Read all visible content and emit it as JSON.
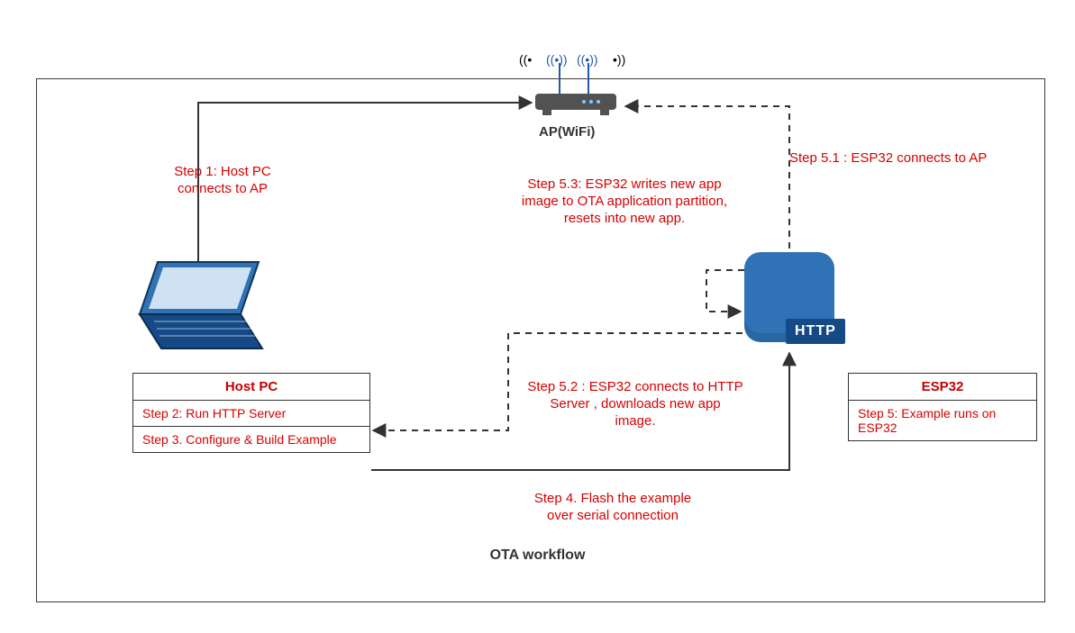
{
  "diagram": {
    "title": "OTA workflow",
    "ap_label": "AP(WiFi)"
  },
  "host_pc": {
    "title": "Host PC",
    "step2": "Step 2: Run HTTP Server",
    "step3": "Step 3. Configure & Build Example"
  },
  "esp32": {
    "title": "ESP32",
    "step5": "Step 5: Example runs on ESP32",
    "http_badge": "HTTP"
  },
  "labels": {
    "step1_line1": "Step 1: Host PC",
    "step1_line2": "connects to AP",
    "step4_line1": "Step 4. Flash the example",
    "step4_line2": "over serial connection",
    "step51": "Step 5.1 :  ESP32 connects to AP",
    "step52_line1": "Step 5.2 :  ESP32 connects to HTTP",
    "step52_line2": "Server , downloads new app",
    "step52_line3": "image.",
    "step53_line1": "Step 5.3:  ESP32 writes new app",
    "step53_line2": "image to OTA application partition,",
    "step53_line3": "resets into new app."
  },
  "chart_data": {
    "type": "diagram",
    "title": "OTA workflow",
    "nodes": [
      {
        "id": "host_pc",
        "label": "Host PC",
        "details": [
          "Step 2: Run HTTP Server",
          "Step 3. Configure & Build Example"
        ]
      },
      {
        "id": "ap",
        "label": "AP(WiFi)"
      },
      {
        "id": "esp32",
        "label": "ESP32",
        "details": [
          "Step 5: Example runs on ESP32"
        ],
        "badge": "HTTP"
      }
    ],
    "edges": [
      {
        "from": "host_pc",
        "to": "ap",
        "style": "solid",
        "label": "Step 1: Host PC connects to AP"
      },
      {
        "from": "host_pc",
        "to": "esp32",
        "style": "solid",
        "label": "Step 4. Flash the example over serial connection"
      },
      {
        "from": "esp32",
        "to": "ap",
        "style": "dashed",
        "label": "Step 5.1 :  ESP32 connects to AP"
      },
      {
        "from": "esp32",
        "to": "host_pc",
        "style": "dashed",
        "label": "Step 5.2 :  ESP32 connects to HTTP Server , downloads new app image."
      },
      {
        "from": "esp32",
        "to": "esp32",
        "style": "dashed",
        "label": "Step 5.3:  ESP32 writes new app image to OTA application partition, resets into new app."
      }
    ]
  }
}
